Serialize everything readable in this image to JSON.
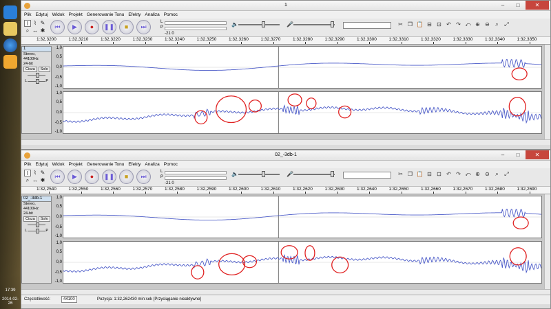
{
  "desktop": {
    "clock_time": "17:39",
    "clock_date": "2014-02-26"
  },
  "menu": [
    "Plik",
    "Edytuj",
    "Widok",
    "Projekt",
    "Generowanie Tonu",
    "Efekty",
    "Analiza",
    "Pomoc"
  ],
  "meter_scale": "-21   0",
  "meter_L": "L",
  "meter_P": "P",
  "window1": {
    "title": "1",
    "ruler": [
      "1:32,3200",
      "1:32,3210",
      "1:32,3220",
      "1:32,3230",
      "1:32,3240",
      "1:32,3250",
      "1:32,3260",
      "1:32,3270",
      "1:32,3280",
      "1:32,3290",
      "1:32,3300",
      "1:32,3310",
      "1:32,3320",
      "1:32,3330",
      "1:32,3340",
      "1:32,3350"
    ],
    "track": {
      "name": "1",
      "format": "Stereo, 44100Hz",
      "bitdepth": "24-bit",
      "mute": "Cisza",
      "solo": "Solo",
      "pan_l": "L",
      "pan_r": "P"
    },
    "scale": [
      "1,0",
      "0,5",
      "0,0",
      "-0,5",
      "-1,0"
    ]
  },
  "window2": {
    "title": "02_-3db-1",
    "ruler": [
      "1:32,2540",
      "1:32,2550",
      "1:32,2560",
      "1:32,2570",
      "1:32,2580",
      "1:32,2590",
      "1:32,2600",
      "1:32,2610",
      "1:32,2620",
      "1:32,2630",
      "1:32,2640",
      "1:32,2650",
      "1:32,2660",
      "1:32,2670",
      "1:32,2680",
      "1:32,2690"
    ],
    "track": {
      "name": "02_-3db-1",
      "format": "Stereo, 44100Hz",
      "bitdepth": "24-bit",
      "mute": "Cisza",
      "solo": "Solo",
      "pan_l": "L",
      "pan_r": "P"
    },
    "scale": [
      "1,0",
      "0,5",
      "0,0",
      "-0,5",
      "-1,0"
    ],
    "status": {
      "rate_label": "Częstotliwość:",
      "rate_value": "44100",
      "position": "Pozycja: 1:32,262430 min:sek  [Przyciąganie nieaktywne]"
    }
  },
  "colors": {
    "waveform": "#4a5ac8",
    "annotation": "#e02020",
    "taskbar_accent": "#e8a23a"
  }
}
